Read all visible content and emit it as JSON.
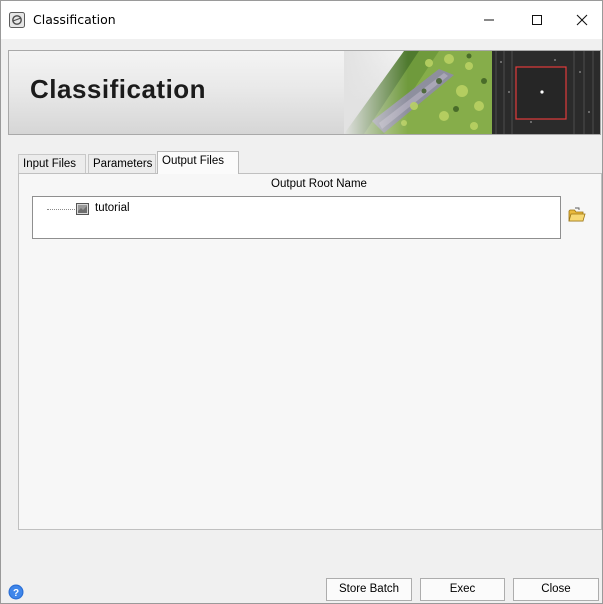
{
  "window": {
    "title": "Classification",
    "controls": {
      "minimize": "minimize-icon",
      "maximize": "maximize-icon",
      "close": "close-icon"
    }
  },
  "banner": {
    "title": "Classification"
  },
  "tabs": [
    {
      "label": "Input Files",
      "active": false
    },
    {
      "label": "Parameters",
      "active": false
    },
    {
      "label": "Output Files",
      "active": true
    }
  ],
  "output_files": {
    "column_header": "Output Root Name",
    "items": [
      {
        "label": "tutorial",
        "icon": "raster-file-icon"
      }
    ],
    "browse_icon": "folder-open-icon"
  },
  "footer": {
    "help_icon": "help-icon",
    "store_batch_label": "Store Batch",
    "exec_label": "Exec",
    "close_label": "Close"
  },
  "colors": {
    "help_blue": "#2a6fd6",
    "folder_yellow": "#f2c94c",
    "banner_accent": "#e23b3b"
  }
}
